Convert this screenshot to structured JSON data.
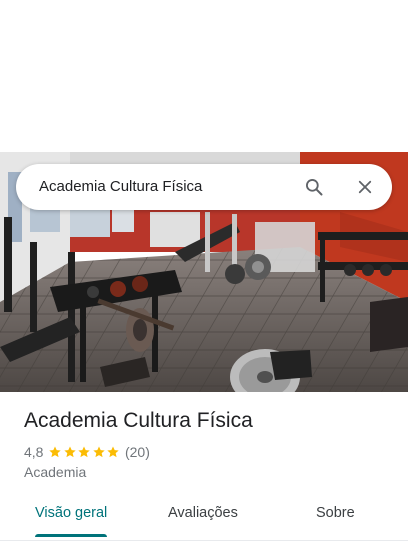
{
  "search": {
    "query": "Academia Cultura Física",
    "search_icon": "search-icon",
    "close_icon": "close-icon"
  },
  "photo": {
    "description_icon": "gym-interior-photo"
  },
  "place": {
    "name": "Academia Cultura Física",
    "rating": "4,8",
    "stars": 5,
    "review_count": "(20)",
    "category": "Academia"
  },
  "tabs": [
    {
      "label": "Visão geral",
      "active": true
    },
    {
      "label": "Avaliações",
      "active": false
    },
    {
      "label": "Sobre",
      "active": false
    }
  ],
  "colors": {
    "accent": "#00737a",
    "star": "#fbbc04",
    "text_primary": "#202124",
    "text_secondary": "#70757a",
    "wall": "#c0381f"
  }
}
